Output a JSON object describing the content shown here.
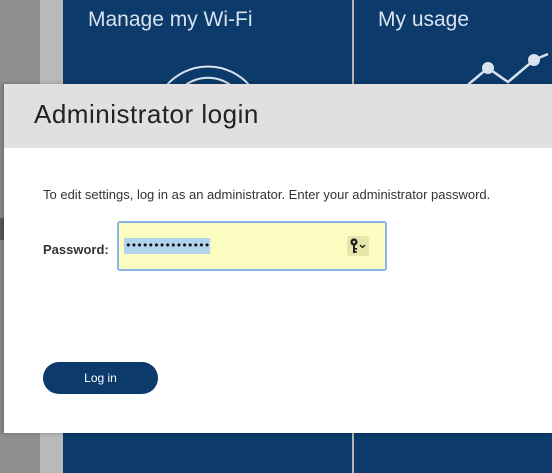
{
  "background": {
    "tiles": [
      {
        "title": "Manage my Wi-Fi",
        "icon": "wifi-icon"
      },
      {
        "title": "My usage",
        "icon": "usage-graph-icon"
      }
    ]
  },
  "dialog": {
    "title": "Administrator login",
    "instructions": "To edit settings, log in as an administrator. Enter your administrator password.",
    "password_label": "Password:",
    "password_value": "•••••••••••••••",
    "password_manager_icon": "key-icon",
    "login_label": "Log in"
  },
  "colors": {
    "brand_navy": "#0c3a6b",
    "autofill_yellow": "#fbfcc0",
    "focus_blue": "#8ab5e8"
  }
}
